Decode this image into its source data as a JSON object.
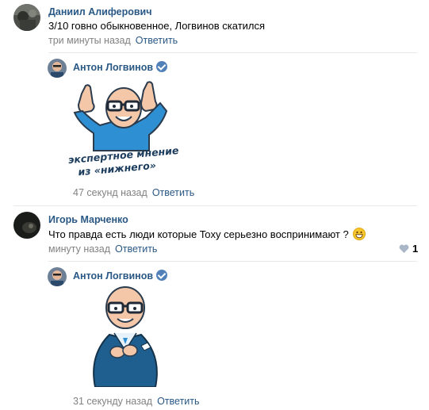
{
  "comments": [
    {
      "author": "Даниил Алиферович",
      "text": "3/10 говно обыкновенное, Логвинов скатился",
      "time": "три минуты назад",
      "reply": "Ответить"
    },
    {
      "author": "Антон Логвинов",
      "verified": true,
      "sticker": {
        "line1": "экспертное мнение",
        "line2": "из «нижнего»"
      },
      "time": "47 секунд назад",
      "reply": "Ответить"
    },
    {
      "author": "Игорь Марченко",
      "text": "Что правда есть люди которые Toxy серьезно воспринимают ?",
      "time": "минуту назад",
      "reply": "Ответить",
      "likes": "1"
    },
    {
      "author": "Антон Логвинов",
      "verified": true,
      "time": "31 секунду назад",
      "reply": "Ответить"
    }
  ],
  "colors": {
    "link": "#2a5885",
    "meta": "#828282",
    "verified": "#5181b8",
    "divider": "#e7e8ec",
    "sticker_shirt": "#2f8fd3",
    "sticker_suit": "#1f5f8f"
  },
  "icons": [
    "verified-icon",
    "heart-icon",
    "grinning-emoji-icon"
  ]
}
